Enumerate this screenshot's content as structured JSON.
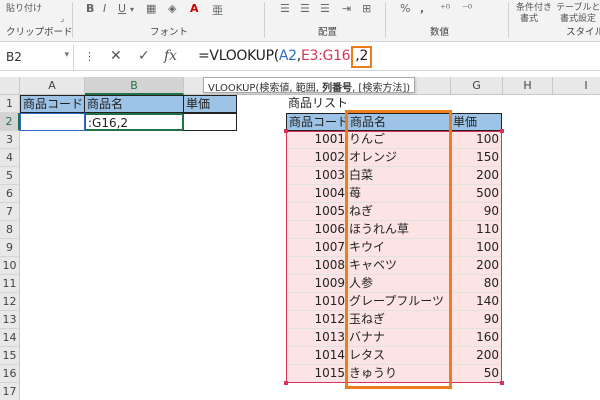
{
  "ribbon": {
    "paste_label": "貼り付け",
    "clipboard_group": "クリップボード",
    "font_group": "フォント",
    "align_group": "配置",
    "number_group": "数値",
    "style_group": "スタイル",
    "conditional_label": "条件付き",
    "format_label": "書式",
    "table_label": "テーブルとし",
    "cellstyle_label": "書式設定",
    "bold": "B",
    "italic": "I",
    "underline": "U",
    "fontcolor": "A",
    "percent": "%",
    "comma": ","
  },
  "formula_bar": {
    "name_box": "B2",
    "formula_prefix": "=VLOOKUP(",
    "arg1": "A2",
    "comma1": ",",
    "arg2": "E3:G16",
    "comma2": ",",
    "arg3": "2",
    "fx": "fx"
  },
  "tooltip": {
    "prefix": "VLOOKUP(検索値, 範囲, ",
    "bold": "列番号",
    "suffix": ", [検索方法])"
  },
  "columns": [
    "A",
    "B",
    "C",
    "D",
    "E",
    "F",
    "G",
    "H",
    "I"
  ],
  "rows": [
    "1",
    "2",
    "3",
    "4",
    "5",
    "6",
    "7",
    "8",
    "9",
    "10",
    "11",
    "12",
    "13",
    "14",
    "15",
    "16",
    "17"
  ],
  "input_table": {
    "h_code": "商品コード",
    "h_name": "商品名",
    "h_price": "単価",
    "b2_text": ":G16,2"
  },
  "product_list": {
    "title": "商品リスト",
    "h_code": "商品コード",
    "h_name": "商品名",
    "h_price": "単価",
    "items": [
      {
        "code": "1001",
        "name": "りんご",
        "price": "100"
      },
      {
        "code": "1002",
        "name": "オレンジ",
        "price": "150"
      },
      {
        "code": "1003",
        "name": "白菜",
        "price": "200"
      },
      {
        "code": "1004",
        "name": "苺",
        "price": "500"
      },
      {
        "code": "1005",
        "name": "ねぎ",
        "price": "90"
      },
      {
        "code": "1006",
        "name": "ほうれん草",
        "price": "110"
      },
      {
        "code": "1007",
        "name": "キウイ",
        "price": "100"
      },
      {
        "code": "1008",
        "name": "キャベツ",
        "price": "200"
      },
      {
        "code": "1009",
        "name": "人参",
        "price": "80"
      },
      {
        "code": "1010",
        "name": "グレープフルーツ",
        "price": "140"
      },
      {
        "code": "1012",
        "name": "玉ねぎ",
        "price": "90"
      },
      {
        "code": "1013",
        "name": "バナナ",
        "price": "160"
      },
      {
        "code": "1014",
        "name": "レタス",
        "price": "200"
      },
      {
        "code": "1015",
        "name": "きゅうり",
        "price": "50"
      }
    ]
  },
  "colors": {
    "accent_orange": "#ee7d1e",
    "ref_blue": "#2d69c8",
    "ref_red": "#d7335a",
    "header_blue": "#9dc3e6",
    "range_pink": "#fce4e4",
    "excel_green": "#217346"
  }
}
